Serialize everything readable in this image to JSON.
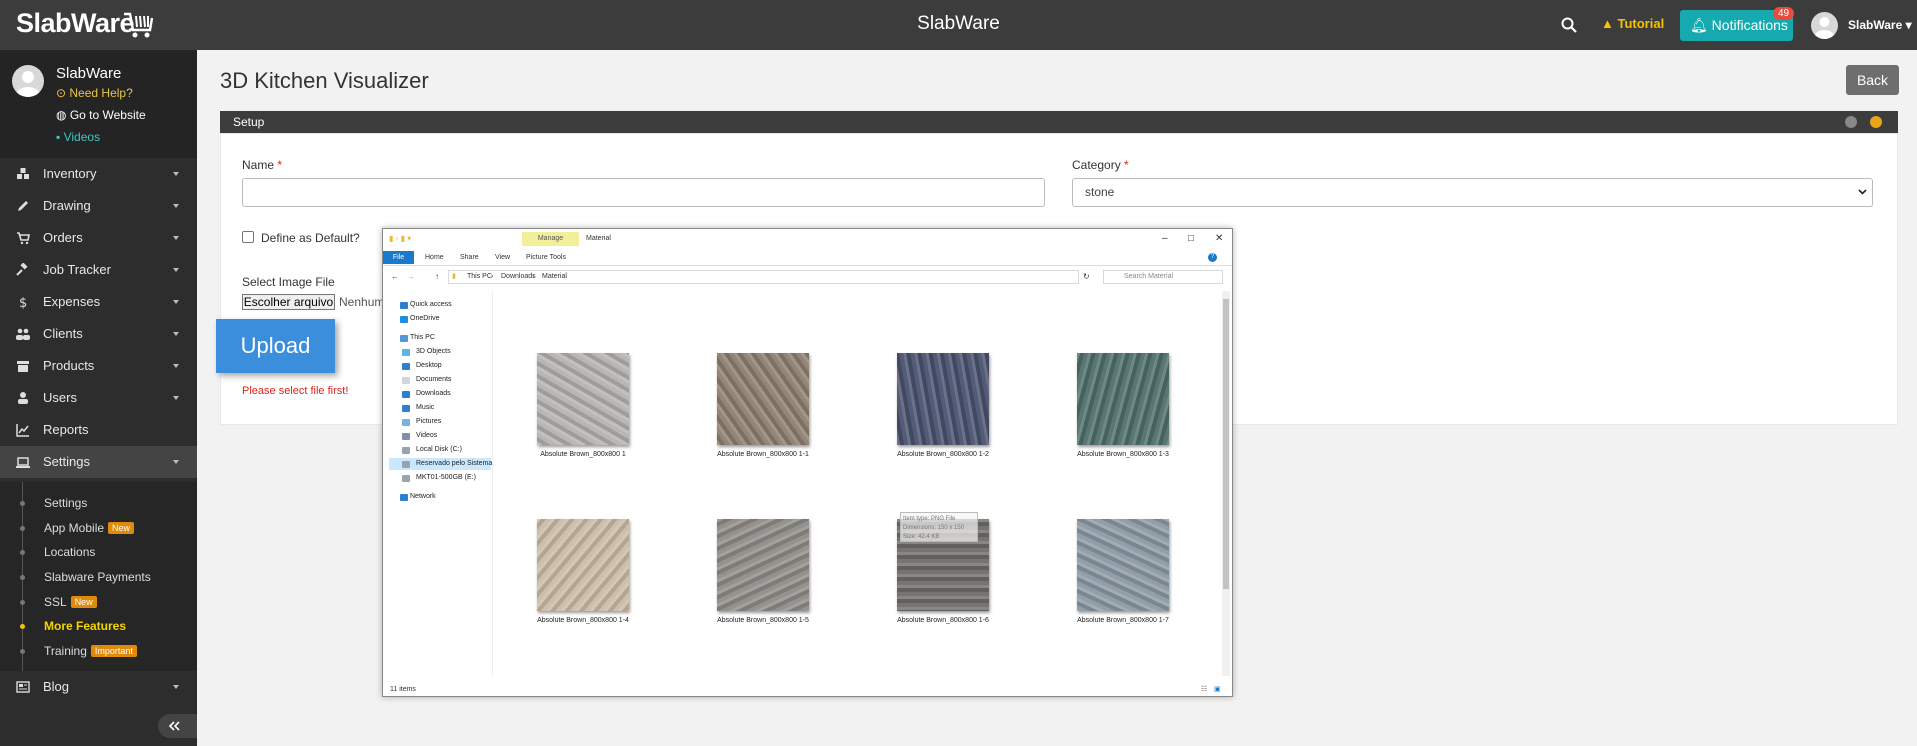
{
  "topbar": {
    "logo_text": "SlabWare",
    "app_title": "SlabWare",
    "tutorial_label": "Tutorial",
    "notifications_label": "Notifications",
    "notifications_count": "49",
    "user_name": "SlabWare"
  },
  "sidebar": {
    "profile": {
      "name": "SlabWare",
      "need_help": "Need Help?",
      "go_to_website": "Go to Website",
      "videos": "Videos"
    },
    "items": [
      {
        "label": "Inventory",
        "icon": "cubes-icon"
      },
      {
        "label": "Drawing",
        "icon": "pencil-icon"
      },
      {
        "label": "Orders",
        "icon": "cart-icon"
      },
      {
        "label": "Job Tracker",
        "icon": "gavel-icon"
      },
      {
        "label": "Expenses",
        "icon": "dollar-icon"
      },
      {
        "label": "Clients",
        "icon": "users-icon"
      },
      {
        "label": "Products",
        "icon": "box-icon"
      },
      {
        "label": "Users",
        "icon": "user-icon"
      },
      {
        "label": "Reports",
        "icon": "chart-line-icon"
      },
      {
        "label": "Settings",
        "icon": "laptop-icon"
      },
      {
        "label": "Blog",
        "icon": "newspaper-icon"
      }
    ],
    "submenu": [
      {
        "label": "Settings"
      },
      {
        "label": "App Mobile",
        "badge": "New"
      },
      {
        "label": "Locations"
      },
      {
        "label": "Slabware Payments"
      },
      {
        "label": "SSL",
        "badge": "New"
      },
      {
        "label": "More Features"
      },
      {
        "label": "Training",
        "badge": "Important"
      }
    ]
  },
  "main": {
    "page_title": "3D Kitchen Visualizer",
    "back_label": "Back",
    "panel_title": "Setup",
    "name_label": "Name",
    "name_value": "",
    "category_label": "Category",
    "category_value": "stone",
    "required_mark": "*",
    "default_label": "Define as Default?",
    "image_label": "Select Image File",
    "choose_file_label": "Escolher arquivo",
    "no_file_text": "Nenhum",
    "upload_label": "Upload",
    "error_text": "Please select file first!"
  },
  "explorer": {
    "title": "Material",
    "manage_tab": "Manage",
    "picture_tools": "Picture Tools",
    "ribbon_tabs": [
      "File",
      "Home",
      "Share",
      "View"
    ],
    "breadcrumb": [
      "This PC",
      "Downloads",
      "Material"
    ],
    "search_placeholder": "Search Material",
    "tree": [
      "Quick access",
      "OneDrive",
      "This PC",
      "3D Objects",
      "Desktop",
      "Documents",
      "Downloads",
      "Music",
      "Pictures",
      "Videos",
      "Local Disk (C:)",
      "Reservado pelo Sistema",
      "MKT01-500GB (E:)",
      "Network"
    ],
    "files": [
      {
        "name": "Absolute Brown_800x800 1",
        "color": "#b5b3b0"
      },
      {
        "name": "Absolute Brown_800x800 1-1",
        "color": "#8d7f70"
      },
      {
        "name": "Absolute Brown_800x800 1-2",
        "color": "#4a5270"
      },
      {
        "name": "Absolute Brown_800x800 1-3",
        "color": "#4f6f6c"
      },
      {
        "name": "Absolute Brown_800x800 1-4",
        "color": "#cbbca5"
      },
      {
        "name": "Absolute Brown_800x800 1-5",
        "color": "#8f8c88"
      },
      {
        "name": "Absolute Brown_800x800 1-6",
        "color": "#6f6d68"
      },
      {
        "name": "Absolute Brown_800x800 1-7",
        "color": "#8c9aa4"
      }
    ],
    "tooltip_lines": [
      "Item type: PNG File",
      "Dimensions: 150 x 150",
      "Size: 42.4 KB"
    ],
    "status": "11 items"
  }
}
